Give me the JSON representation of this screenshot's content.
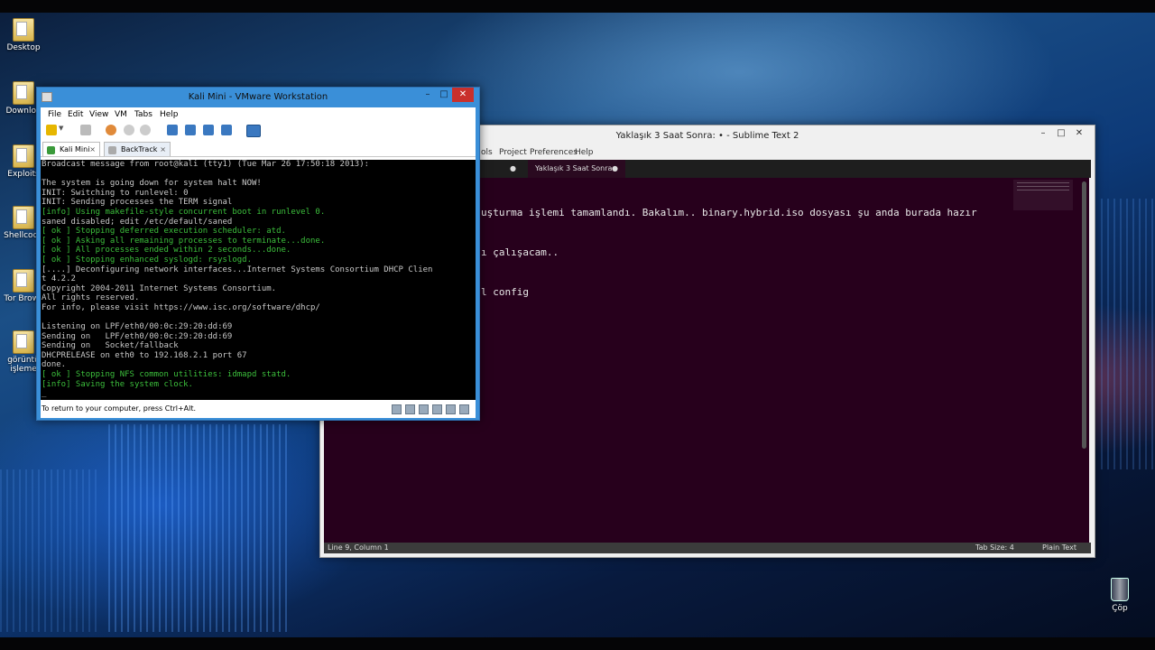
{
  "desktop": {
    "icons": [
      {
        "label": "Desktop"
      },
      {
        "label": "Downloa"
      },
      {
        "label": "Exploits"
      },
      {
        "label": "Shellcode"
      },
      {
        "label": "Tor Brows"
      },
      {
        "label": "görüntü işleme"
      }
    ],
    "trash_label": "Çöp"
  },
  "sublime": {
    "title": "Yaklaşık 3 Saat Sonra: • - Sublime Text 2",
    "menu": [
      "ols",
      "Project",
      "Preferences",
      "Help"
    ],
    "tab_label": "Yaklaşık 3 Saat Sonra:",
    "lines": [
      "uşturma işlemi tamamlandı. Bakalım.. binary.hybrid.iso dosyası şu anda burada hazır",
      "ı çalışacam..",
      "l config"
    ],
    "status_left": "Line 9, Column 1",
    "tab_size": "Tab Size: 4",
    "syntax": "Plain Text"
  },
  "vmware": {
    "title": "Kali Mini - VMware Workstation",
    "menu": [
      "File",
      "Edit",
      "View",
      "VM",
      "Tabs",
      "Help"
    ],
    "tabs": [
      {
        "label": "Kali Mini",
        "active": true
      },
      {
        "label": "BackTrack",
        "active": false
      }
    ],
    "console_lines": [
      "Broadcast message from root@kali (tty1) (Tue Mar 26 17:50:18 2013):",
      "",
      "The system is going down for system halt NOW!",
      "INIT: Switching to runlevel: 0",
      "INIT: Sending processes the TERM signal",
      "[info] Using makefile-style concurrent boot in runlevel 0.",
      "saned disabled; edit /etc/default/saned",
      "[ ok ] Stopping deferred execution scheduler: atd.",
      "[ ok ] Asking all remaining processes to terminate...done.",
      "[ ok ] All processes ended within 2 seconds...done.",
      "[ ok ] Stopping enhanced syslogd: rsyslogd.",
      "[....] Deconfiguring network interfaces...Internet Systems Consortium DHCP Clien",
      "t 4.2.2",
      "Copyright 2004-2011 Internet Systems Consortium.",
      "All rights reserved.",
      "For info, please visit https://www.isc.org/software/dhcp/",
      "",
      "Listening on LPF/eth0/00:0c:29:20:dd:69",
      "Sending on   LPF/eth0/00:0c:29:20:dd:69",
      "Sending on   Socket/fallback",
      "DHCPRELEASE on eth0 to 192.168.2.1 port 67",
      "done.",
      "[ ok ] Stopping NFS common utilities: idmapd statd.",
      "[info] Saving the system clock.",
      "_"
    ],
    "status_text": "To return to your computer, press Ctrl+Alt."
  }
}
